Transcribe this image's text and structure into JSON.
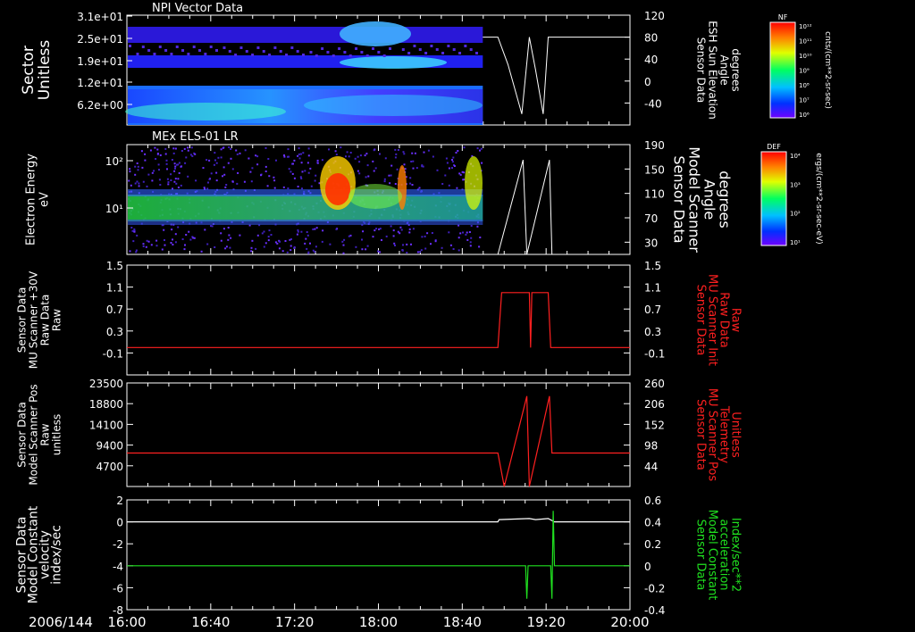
{
  "date_label": "2006/144",
  "time_axis": {
    "labels": [
      "16:00",
      "16:40",
      "17:20",
      "18:00",
      "18:40",
      "19:20",
      "20:00"
    ],
    "range_hours": [
      16,
      20
    ]
  },
  "colorbars": [
    {
      "name": "NF",
      "units": "cnts/(cm**2-sr-sec)",
      "ticks": [
        "10¹²",
        "10¹¹",
        "10¹⁰",
        "10⁹",
        "10⁸",
        "10⁷",
        "10⁶"
      ]
    },
    {
      "name": "DEF",
      "units": "ergs/(cm**2-sr-sec-eV)",
      "ticks": [
        "10⁴",
        "10³",
        "10²",
        "10¹"
      ]
    }
  ],
  "chart_data": [
    {
      "type": "heatmap",
      "title": "NPI Vector Data",
      "ylabel": [
        "Sector",
        "Unitless"
      ],
      "yticks": [
        "3.1e+01",
        "2.5e+01",
        "1.9e+01",
        "1.2e+01",
        "6.2e+00"
      ],
      "y2label": [
        "Sensor Data",
        "ESH Sun Elevation",
        "Angle",
        "degrees"
      ],
      "y2ticks": [
        120,
        80,
        40,
        0,
        -40
      ],
      "y2lim": [
        -80,
        120
      ],
      "data_end_hour": 18.83,
      "line_series": {
        "name": "ESH Sun Elevation Angle",
        "color": "#ffffff",
        "points": [
          [
            16.0,
            80
          ],
          [
            18.95,
            80
          ],
          [
            19.03,
            30
          ],
          [
            19.14,
            -60
          ],
          [
            19.2,
            80
          ],
          [
            19.25,
            20
          ],
          [
            19.31,
            -60
          ],
          [
            19.35,
            80
          ],
          [
            20.0,
            80
          ]
        ]
      }
    },
    {
      "type": "heatmap",
      "title": "MEx ELS-01 LR",
      "ylabel": [
        "Electron Energy",
        "eV"
      ],
      "yticks": [
        "10²",
        "10¹"
      ],
      "y2label": [
        "Sensor Data",
        "Model Scanner",
        "Angle",
        "degrees"
      ],
      "y2ticks": [
        190,
        150,
        110,
        70,
        30
      ],
      "y2lim": [
        10,
        190
      ],
      "data_end_hour": 18.83,
      "line_series": {
        "name": "Model Scanner Angle",
        "color": "#ffffff",
        "points": [
          [
            18.83,
            10
          ],
          [
            18.95,
            10
          ],
          [
            19.15,
            165
          ],
          [
            19.18,
            10
          ],
          [
            19.36,
            165
          ],
          [
            19.38,
            10
          ],
          [
            20.0,
            10
          ]
        ]
      }
    },
    {
      "type": "line",
      "ylabel": [
        "Sensor Data",
        "MU Scanner +30V",
        "Raw Data",
        "Raw"
      ],
      "yticks": [
        1.5,
        1.1,
        0.7,
        0.3,
        -0.1
      ],
      "ylim": [
        -0.5,
        1.5
      ],
      "y2label": [
        "Sensor Data",
        "MU Scanner Init",
        "Raw Data",
        "Raw"
      ],
      "y2ticks": [
        1.5,
        1.1,
        0.7,
        0.3,
        -0.1
      ],
      "series": [
        {
          "name": "MU Scanner Init Raw",
          "color": "#ff2020",
          "points": [
            [
              16.0,
              0.0
            ],
            [
              18.95,
              0.0
            ],
            [
              18.98,
              1.0
            ],
            [
              19.2,
              1.0
            ],
            [
              19.21,
              0.0
            ],
            [
              19.22,
              1.0
            ],
            [
              19.35,
              1.0
            ],
            [
              19.37,
              0.0
            ],
            [
              20.0,
              0.0
            ]
          ]
        }
      ]
    },
    {
      "type": "line",
      "ylabel": [
        "Sensor Data",
        "Model Scanner Pos",
        "Raw",
        "unitless"
      ],
      "yticks": [
        23500,
        18800,
        14100,
        9400,
        4700
      ],
      "ylim": [
        0,
        23500
      ],
      "y2label": [
        "Sensor Data",
        "MU Scanner Pos",
        "Telemetry",
        "Unitless"
      ],
      "y2ticks": [
        260,
        206,
        152,
        98,
        44
      ],
      "series": [
        {
          "name": "MU Scanner Pos Telemetry",
          "color": "#ff2020",
          "points": [
            [
              16.0,
              7600
            ],
            [
              18.95,
              7600
            ],
            [
              19.0,
              0
            ],
            [
              19.18,
              20500
            ],
            [
              19.2,
              0
            ],
            [
              19.36,
              20500
            ],
            [
              19.38,
              7600
            ],
            [
              20.0,
              7600
            ]
          ]
        }
      ]
    },
    {
      "type": "line",
      "ylabel": [
        "Sensor Data",
        "Model Constant",
        "velocity",
        "index/sec"
      ],
      "yticks": [
        2,
        0,
        -2,
        -4,
        -6,
        -8
      ],
      "ylim": [
        -8,
        2
      ],
      "y2label": [
        "Sensor Data",
        "Model Constant",
        "acceleration",
        "Index/sec**2"
      ],
      "y2ticks": [
        0.6,
        0.4,
        0.2,
        0.0,
        -0.2,
        -0.4
      ],
      "series": [
        {
          "name": "Model Constant velocity",
          "color": "#ffffff",
          "points": [
            [
              16.0,
              0
            ],
            [
              18.95,
              0
            ],
            [
              18.96,
              0.2
            ],
            [
              19.2,
              0.3
            ],
            [
              19.25,
              0.2
            ],
            [
              19.35,
              0.3
            ],
            [
              19.4,
              0
            ],
            [
              20.0,
              0
            ]
          ]
        },
        {
          "name": "Model Constant acceleration",
          "color": "#20e020",
          "points": [
            [
              16.0,
              -4
            ],
            [
              19.17,
              -4
            ],
            [
              19.18,
              -7
            ],
            [
              19.19,
              -4
            ],
            [
              19.37,
              -4
            ],
            [
              19.38,
              -7
            ],
            [
              19.39,
              1
            ],
            [
              19.4,
              -4
            ],
            [
              20.0,
              -4
            ]
          ]
        }
      ]
    }
  ]
}
